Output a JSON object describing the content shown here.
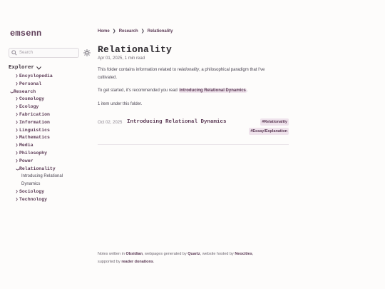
{
  "site": {
    "title": "emsenn"
  },
  "search": {
    "placeholder": "Search"
  },
  "explorer": {
    "label": "Explorer",
    "items": [
      {
        "label": "Encyclopedia",
        "state": "closed"
      },
      {
        "label": "Personal",
        "state": "closed"
      },
      {
        "label": "Research",
        "state": "open"
      }
    ],
    "research_children": [
      {
        "label": "Cosmology"
      },
      {
        "label": "Ecology"
      },
      {
        "label": "Fabrication"
      },
      {
        "label": "Information"
      },
      {
        "label": "Linguistics"
      },
      {
        "label": "Mathematics"
      },
      {
        "label": "Media"
      },
      {
        "label": "Philosophy"
      },
      {
        "label": "Power"
      },
      {
        "label": "Relationality",
        "state": "open"
      },
      {
        "label": "Sociology"
      },
      {
        "label": "Technology"
      }
    ],
    "relationality_children": [
      {
        "line1": "Introducing Relational",
        "line2": "Dynamics"
      }
    ]
  },
  "breadcrumb": {
    "items": [
      "Home",
      "Research",
      "Relationality"
    ]
  },
  "page": {
    "title": "Relationality",
    "date": "Apr 01, 2025,",
    "read_time": "1 min read",
    "intro_before": "This folder contains information related to ",
    "intro_italic": "relationality",
    "intro_after": ", a philosophical paradigm that I've cultivated.",
    "start_before": "To get started, it's recommended you read ",
    "start_link": "Introducing Relational Dynamics",
    "start_after": ".",
    "count_text": "1 item under this folder."
  },
  "entries": [
    {
      "date": "Oct 02, 2025",
      "title": "Introducing Relational Dynamics",
      "tags": [
        "#Relationality",
        "#Essay/Explanation"
      ]
    }
  ],
  "footer": {
    "t1": "Notes written in ",
    "l1": "Obsidian",
    "t2": ", webpages generated by ",
    "l2": "Quartz",
    "t3": ", website hosted by ",
    "l3": "Neocities",
    "t4": ",",
    "t5": "supported by ",
    "l4": "reader donations",
    "t6": "."
  },
  "colors": {
    "accent": "#5b3a55",
    "highlight_bg": "#efe3ec",
    "text": "#4a4552",
    "background": "#fdfcfb"
  }
}
